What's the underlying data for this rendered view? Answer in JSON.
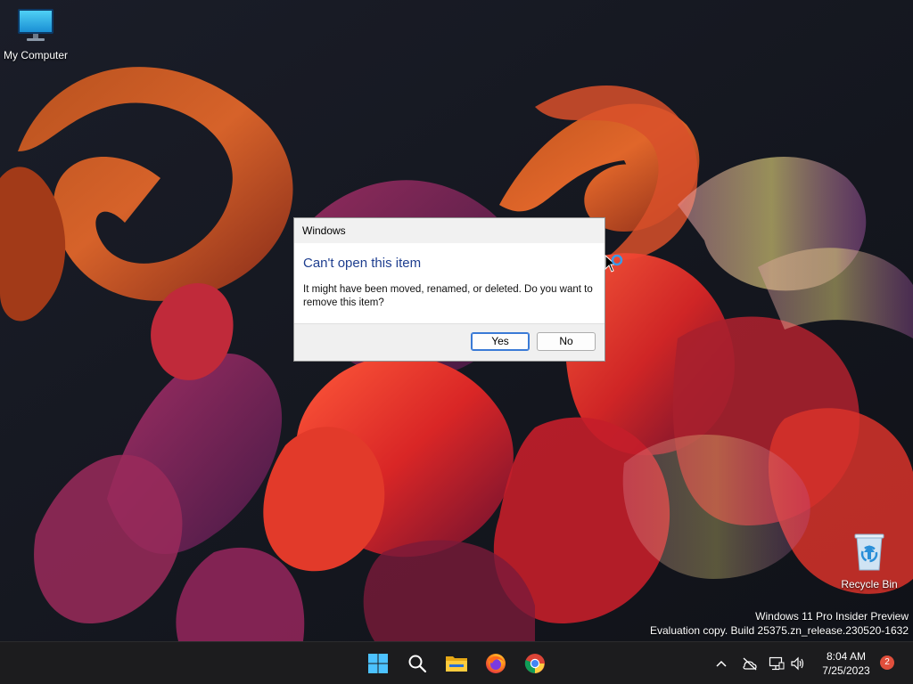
{
  "desktop": {
    "icons": [
      {
        "label": "My Computer",
        "icon": "monitor-icon"
      },
      {
        "label": "Recycle Bin",
        "icon": "recycle-bin-icon"
      }
    ],
    "watermark": {
      "line1": "Windows 11 Pro Insider Preview",
      "line2": "Evaluation copy. Build 25375.zn_release.230520-1632"
    }
  },
  "dialog": {
    "title": "Windows",
    "heading": "Can't open this item",
    "message": "It might have been moved, renamed, or deleted. Do you want to remove this item?",
    "buttons": {
      "yes": "Yes",
      "no": "No"
    },
    "default_button": "yes",
    "heading_color": "#1e3e8f"
  },
  "taskbar": {
    "apps": [
      {
        "name": "Start",
        "icon": "windows-logo-icon"
      },
      {
        "name": "Search",
        "icon": "search-icon"
      },
      {
        "name": "File Explorer",
        "icon": "folder-icon"
      },
      {
        "name": "Firefox",
        "icon": "firefox-icon"
      },
      {
        "name": "Chrome",
        "icon": "chrome-icon"
      }
    ],
    "tray": {
      "icons": [
        "chevron-up-icon",
        "network-off-icon",
        "display-icon",
        "volume-icon"
      ],
      "time": "8:04 AM",
      "date": "7/25/2023",
      "notification_count": "2"
    }
  },
  "colors": {
    "accent": "#3a7ad6",
    "taskbar": "#1c1c1e",
    "badge": "#e04f3c"
  }
}
